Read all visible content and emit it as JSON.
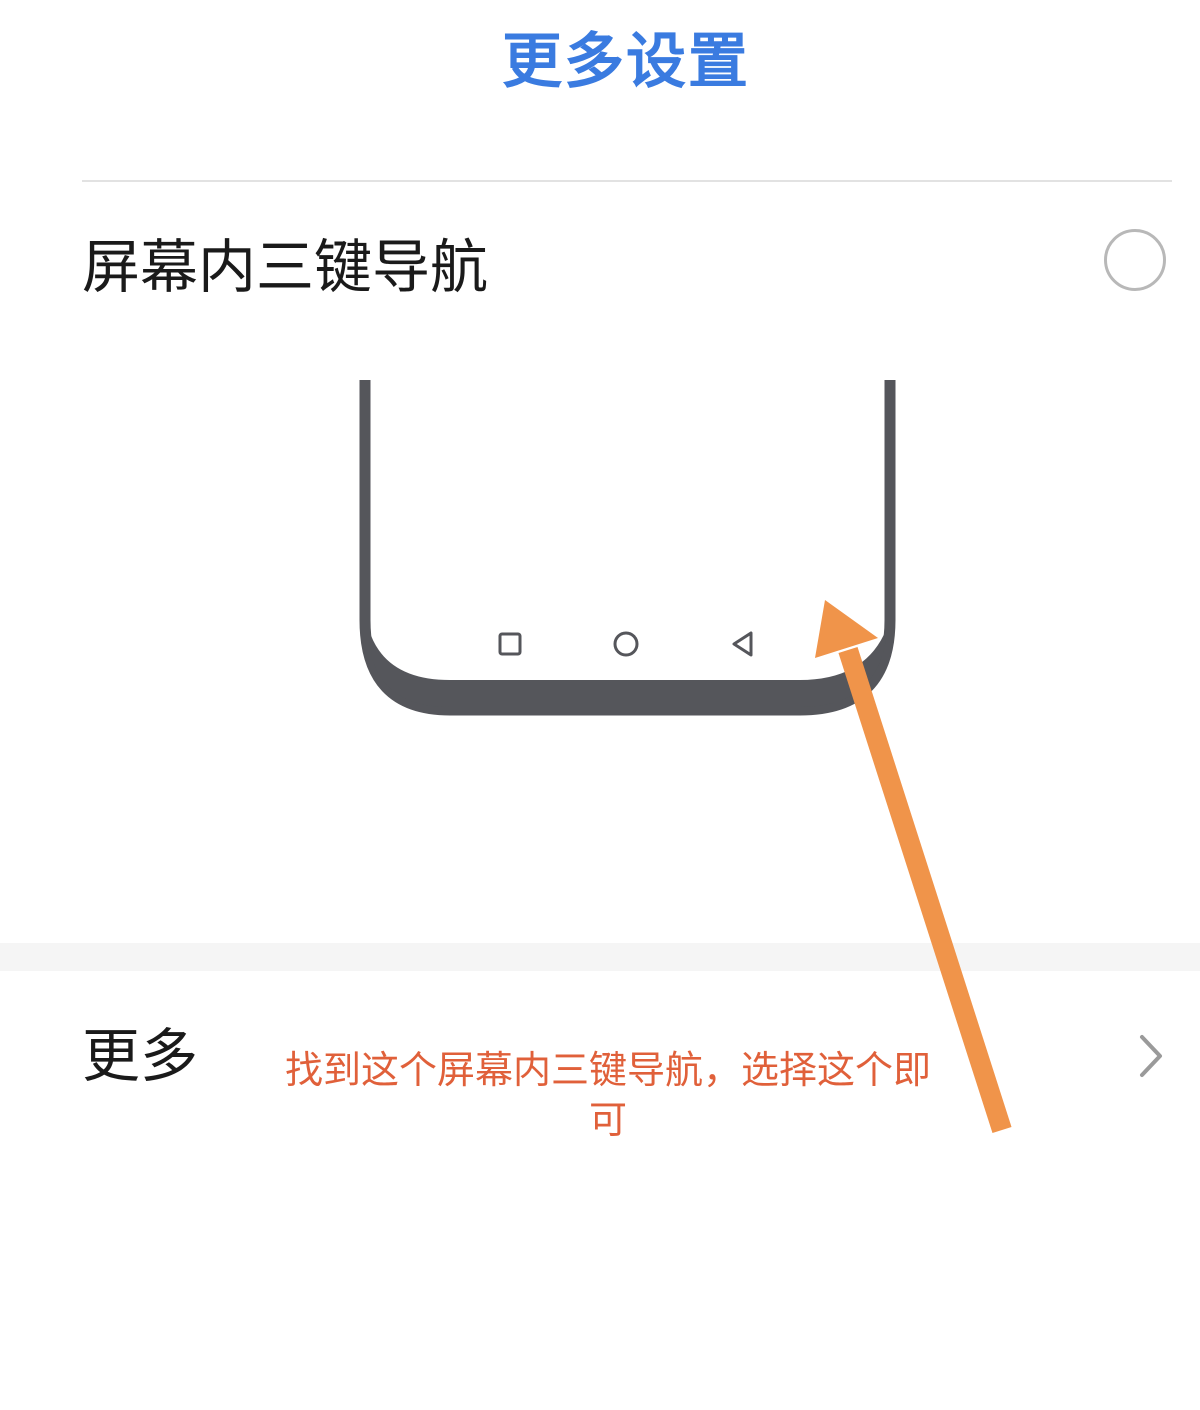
{
  "header": {
    "title": "更多设置",
    "title_color": "#3a7be0"
  },
  "nav_option": {
    "label": "屏幕内三键导航",
    "selected": false
  },
  "illustration": {
    "frame_color": "#55565b",
    "icons": [
      "recent-apps-square-icon",
      "home-circle-icon",
      "back-triangle-icon"
    ]
  },
  "more_row": {
    "label": "更多"
  },
  "annotation": {
    "text": "找到这个屏幕内三键导航，选择这个即可",
    "color": "#e0603a",
    "arrow_color": "#f0944a"
  }
}
